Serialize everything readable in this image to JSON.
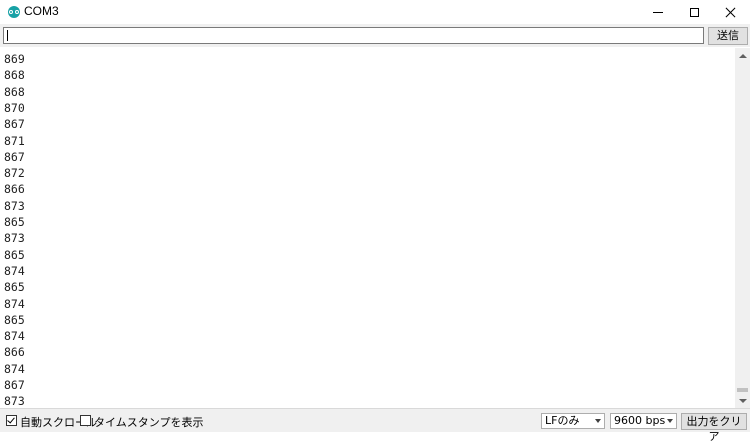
{
  "window": {
    "title": "COM3",
    "icon": "arduino-icon",
    "controls": [
      "minimize-icon",
      "maximize-icon",
      "close-icon"
    ]
  },
  "input_bar": {
    "value": "",
    "send_label": "送信"
  },
  "output_lines": [
    "869",
    "868",
    "868",
    "870",
    "867",
    "871",
    "867",
    "872",
    "866",
    "873",
    "865",
    "873",
    "865",
    "874",
    "865",
    "874",
    "865",
    "874",
    "866",
    "874",
    "867",
    "873"
  ],
  "status_bar": {
    "autoscroll_label": "自動スクロール",
    "autoscroll_checked": true,
    "timestamp_label": "タイムスタンプを表示",
    "timestamp_checked": false,
    "line_ending_value": "LFのみ",
    "baud_value": "9600 bps",
    "clear_label": "出力をクリア"
  }
}
